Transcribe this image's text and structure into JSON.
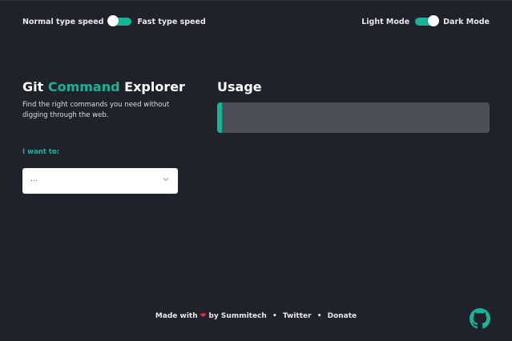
{
  "speed": {
    "left_label": "Normal type speed",
    "right_label": "Fast type speed",
    "state": "normal"
  },
  "mode": {
    "left_label": "Light Mode",
    "right_label": "Dark Mode",
    "state": "dark"
  },
  "header": {
    "title_part1": "Git ",
    "title_accent": "Command",
    "title_part2": " Explorer",
    "subtitle": "Find the right commands you need without digging through the web."
  },
  "form": {
    "want_label": "I want to:",
    "select_value": "..."
  },
  "usage": {
    "title": "Usage",
    "content": ""
  },
  "footer": {
    "made_with": "Made with",
    "by": "by Summitech",
    "twitter": "Twitter",
    "donate": "Donate",
    "separator": "•"
  },
  "colors": {
    "background": "#1f222a",
    "accent": "#16b59a",
    "usage_box": "#4c4f57",
    "heart": "#e0303a"
  },
  "icons": {
    "heart": "heart-icon",
    "chevron": "chevron-down-icon",
    "github": "github-icon"
  }
}
